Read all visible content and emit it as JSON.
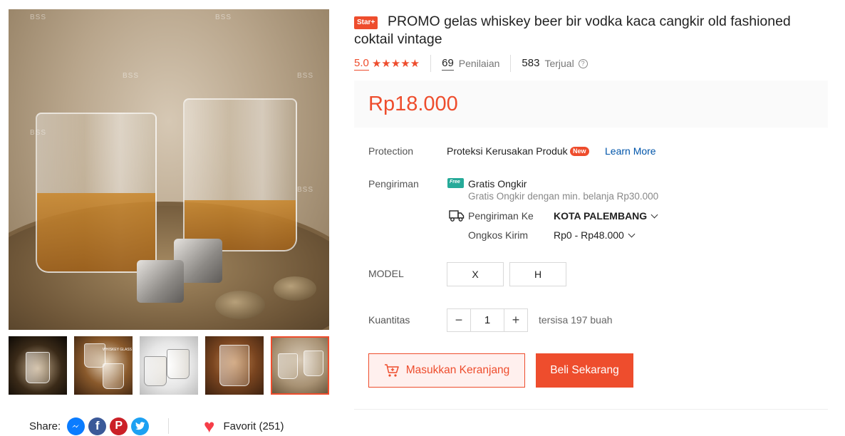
{
  "product": {
    "badge": "Star+",
    "title": "PROMO gelas whiskey beer bir vodka kaca cangkir old fashioned coktail vintage",
    "rating": "5.0",
    "stars": "★★★★★",
    "reviews_count": "69",
    "reviews_label": "Penilaian",
    "sold_count": "583",
    "sold_label": "Terjual",
    "price": "Rp18.000"
  },
  "gallery": {
    "watermark": "BSS",
    "thumbnail_label": "WHISKEY GLASS",
    "thumbnail_count": 5,
    "active_thumbnail": 5
  },
  "protection": {
    "label": "Protection",
    "value": "Proteksi Kerusakan Produk",
    "badge": "New",
    "link": "Learn More"
  },
  "shipping": {
    "label": "Pengiriman",
    "free_icon": "Free",
    "free_title": "Gratis Ongkir",
    "free_desc": "Gratis Ongkir dengan min. belanja Rp30.000",
    "to_label": "Pengiriman Ke",
    "to_value": "KOTA PALEMBANG",
    "cost_label": "Ongkos Kirim",
    "cost_value": "Rp0 - Rp48.000"
  },
  "model": {
    "label": "MODEL",
    "options": [
      "X",
      "H"
    ]
  },
  "quantity": {
    "label": "Kuantitas",
    "minus": "−",
    "value": "1",
    "plus": "+",
    "stock": "tersisa 197 buah"
  },
  "actions": {
    "add_to_cart": "Masukkan Keranjang",
    "buy_now": "Beli Sekarang"
  },
  "share": {
    "label": "Share:",
    "icons": [
      "messenger-icon",
      "facebook-icon",
      "pinterest-icon",
      "twitter-icon"
    ],
    "fb": "f",
    "pin": "P",
    "tw": "t"
  },
  "favorite": {
    "label": "Favorit (251)"
  },
  "colors": {
    "accent": "#ee4d2d",
    "link": "#0055aa",
    "free_shipping": "#26aa99"
  }
}
